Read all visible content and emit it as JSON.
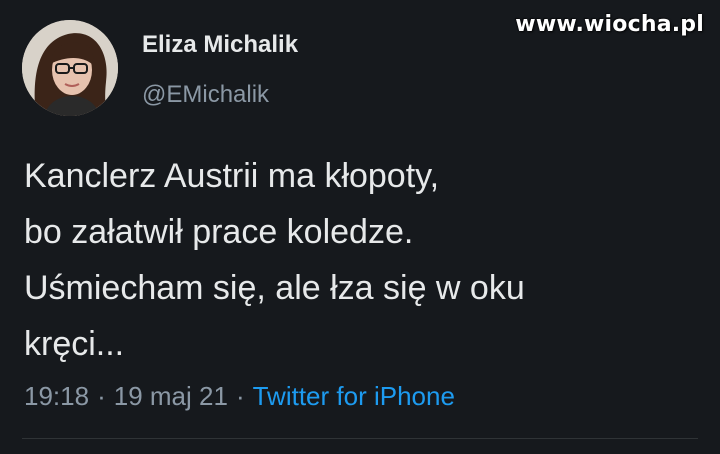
{
  "watermark": "www.wiocha.pl",
  "author": {
    "name": "Eliza Michalik",
    "handle": "@EMichalik"
  },
  "tweet": {
    "lines": [
      "Kanclerz Austrii ma kłopoty,",
      "bo załatwił prace koledze.",
      "Uśmiecham się, ale łza się w oku",
      "kręci..."
    ],
    "time": "19:18",
    "date": "19 maj 21",
    "separator": "·",
    "source": "Twitter for iPhone"
  },
  "colors": {
    "background": "#16191d",
    "text": "#e7e9ea",
    "secondary": "#8b98a5",
    "link": "#1d9bf0"
  }
}
